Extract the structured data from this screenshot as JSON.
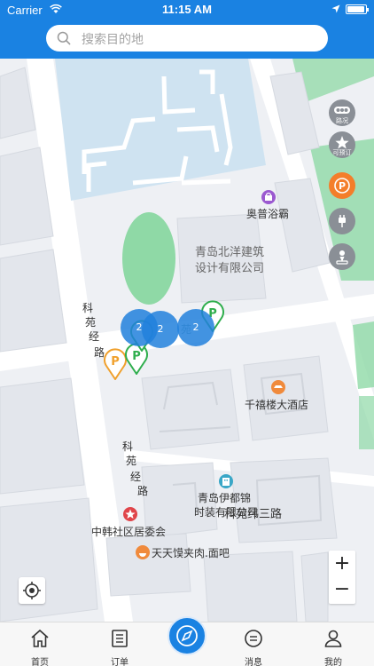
{
  "status_bar": {
    "carrier": "Carrier",
    "time": "11:15 AM"
  },
  "search": {
    "placeholder": "搜索目的地"
  },
  "map": {
    "pois": [
      {
        "name": "奥普浴霸",
        "icon": "shopping-bag-icon",
        "color": "#9b59d0"
      },
      {
        "name": "千禧楼大酒店",
        "icon": "hotel-icon",
        "color": "#f08a3c"
      },
      {
        "name": "青岛伊都锦",
        "icon": "building-icon",
        "color": "#3aa7c7"
      },
      {
        "name": "时装有限公司",
        "icon": "",
        "color": "#3aa7c7"
      },
      {
        "name": "中韩社区居委会",
        "icon": "star-icon",
        "color": "#e0454a"
      },
      {
        "name": "天天馍夹肉.面吧",
        "icon": "restaurant-icon",
        "color": "#f08a3c"
      }
    ],
    "building_label": [
      "青岛北洋建筑",
      "设计有限公司"
    ],
    "roads": {
      "road1_a": "科",
      "road1_b": "苑",
      "road1_c": "经",
      "road1_d": "路",
      "road2_a": "科",
      "road2_b": "苑",
      "road2_c": "经",
      "road2_d": "路",
      "road3": "科苑纬三路",
      "road4": "苑"
    },
    "clusters": [
      {
        "count": "2"
      },
      {
        "count": "2"
      },
      {
        "count": "2"
      }
    ],
    "parking_pin_letter": "P",
    "side_controls": [
      {
        "name": "traffic",
        "label": "路况",
        "icon": "traffic-icon"
      },
      {
        "name": "bookable",
        "label": "可预订",
        "icon": "star-icon"
      },
      {
        "name": "parking",
        "label": "",
        "icon": "parking-icon"
      },
      {
        "name": "charging",
        "label": "",
        "icon": "plug-icon"
      },
      {
        "name": "person",
        "label": "",
        "icon": "person-pin-icon"
      }
    ],
    "zoom_in": "+",
    "zoom_out": "−"
  },
  "tabs": [
    {
      "label": "首页",
      "icon": "home-icon"
    },
    {
      "label": "订单",
      "icon": "order-icon"
    },
    {
      "label": "消息",
      "icon": "message-icon"
    },
    {
      "label": "我的",
      "icon": "user-icon"
    }
  ],
  "colors": {
    "primary": "#1a82e2",
    "cluster": "#2180dc",
    "parking_green": "#2fae4d",
    "parking_orange": "#f0a02c",
    "water": "#cfe3f1",
    "park": "#8fd9a6"
  }
}
